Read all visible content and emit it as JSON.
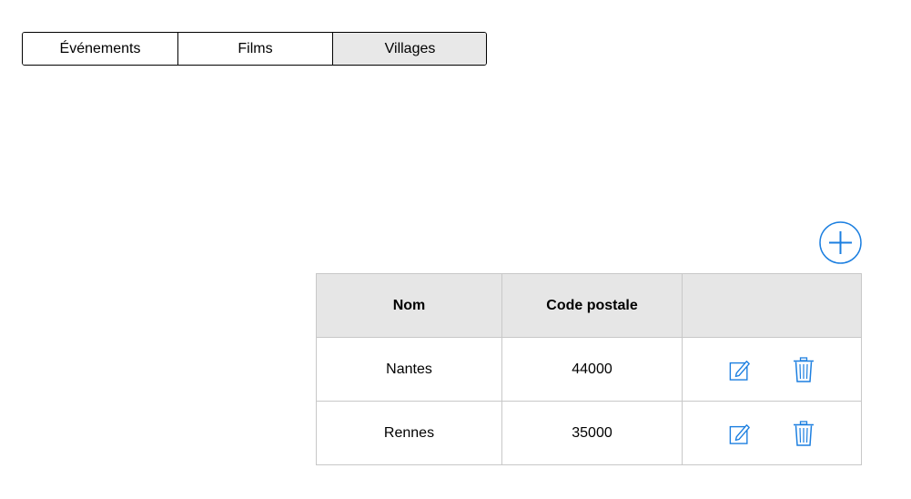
{
  "tabs": [
    {
      "label": "Événements",
      "active": false
    },
    {
      "label": "Films",
      "active": false
    },
    {
      "label": "Villages",
      "active": true
    }
  ],
  "add_button": {
    "icon": "plus-circle-icon",
    "color": "#1c7fe0"
  },
  "table": {
    "headers": [
      "Nom",
      "Code postale",
      ""
    ],
    "rows": [
      {
        "nom": "Nantes",
        "code_postal": "44000"
      },
      {
        "nom": "Rennes",
        "code_postal": "35000"
      }
    ],
    "row_actions": [
      {
        "icon": "edit-icon"
      },
      {
        "icon": "trash-icon"
      }
    ]
  },
  "colors": {
    "accent": "#1c7fe0",
    "header_bg": "#e6e6e6",
    "active_tab_bg": "#e8e8e8",
    "border": "#c8c8c8"
  }
}
